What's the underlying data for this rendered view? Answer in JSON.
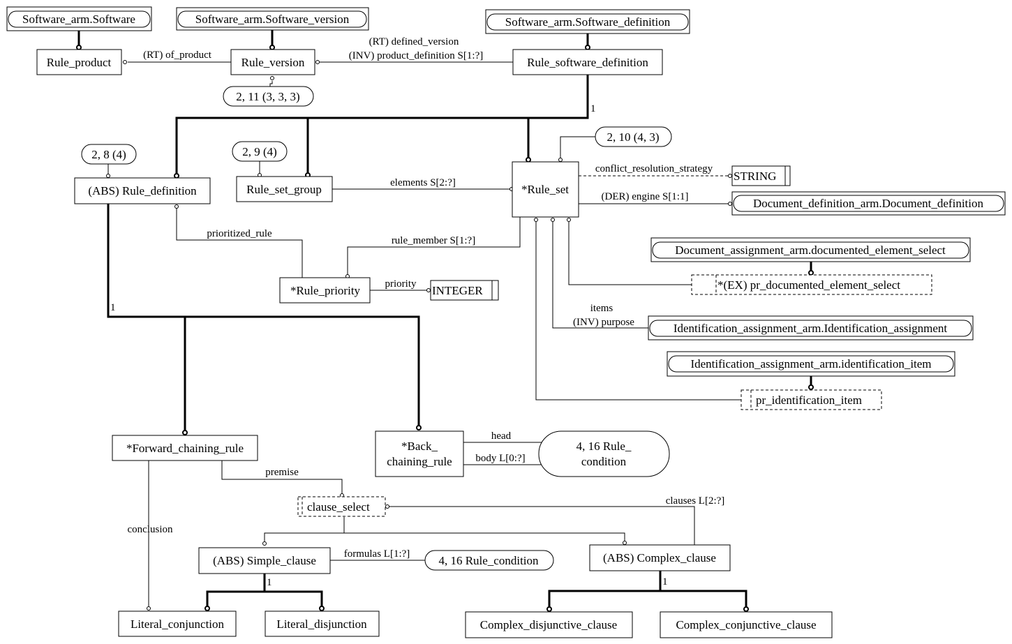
{
  "diagram": {
    "entities": {
      "software": "Software_arm.Software",
      "software_version": "Software_arm.Software_version",
      "software_definition": "Software_arm.Software_definition",
      "rule_product": "Rule_product",
      "rule_version": "Rule_version",
      "rule_software_definition": "Rule_software_definition",
      "rule_definition": "(ABS) Rule_definition",
      "rule_set_group": "Rule_set_group",
      "rule_set": "*Rule_set",
      "rule_priority": "*Rule_priority",
      "integer": "INTEGER",
      "string": "STRING",
      "document_definition": "Document_definition_arm.Document_definition",
      "documented_element_select": "Document_assignment_arm.documented_element_select",
      "pr_documented_element_select": "*(EX) pr_documented_element_select",
      "identification_assignment": "Identification_assignment_arm.Identification_assignment",
      "identification_item": "Identification_assignment_arm.identification_item",
      "pr_identification_item": "pr_identification_item",
      "forward_chaining_rule": "*Forward_chaining_rule",
      "back_chaining_rule_line1": "*Back_",
      "back_chaining_rule_line2": "chaining_rule",
      "rule_condition_ref_line1": "4, 16 Rule_",
      "rule_condition_ref_line2": "condition",
      "clause_select": "clause_select",
      "simple_clause": "(ABS) Simple_clause",
      "complex_clause": "(ABS) Complex_clause",
      "rule_condition_ref2": "4, 16 Rule_condition",
      "literal_conjunction": "Literal_conjunction",
      "literal_disjunction": "Literal_disjunction",
      "complex_disjunctive_clause": "Complex_disjunctive_clause",
      "complex_conjunctive_clause": "Complex_conjunctive_clause"
    },
    "page_refs": {
      "rule_version_ref": "2, 11 (3, 3, 3)",
      "rule_definition_ref": "2, 8 (4)",
      "rule_set_group_ref": "2, 9 (4)",
      "rule_set_ref": "2, 10 (4, 3)"
    },
    "relations": {
      "of_product": "(RT) of_product",
      "defined_version": "(RT) defined_version",
      "product_definition": "(INV) product_definition S[1:?]",
      "elements": "elements S[2:?]",
      "conflict_resolution_strategy": "conflict_resolution_strategy",
      "engine": "(DER) engine S[1:1]",
      "prioritized_rule": "prioritized_rule",
      "rule_member": "rule_member S[1:?]",
      "priority": "priority",
      "items": "items",
      "purpose": "(INV) purpose",
      "head": "head",
      "body": "body L[0:?]",
      "premise": "premise",
      "conclusion": "conclusion",
      "clauses": "clauses L[2:?]",
      "formulas": "formulas L[1:?]"
    },
    "cardinalities": {
      "rule_software_definition_one": "1",
      "rule_definition_one": "1",
      "simple_clause_one": "1",
      "complex_clause_one": "1"
    }
  }
}
